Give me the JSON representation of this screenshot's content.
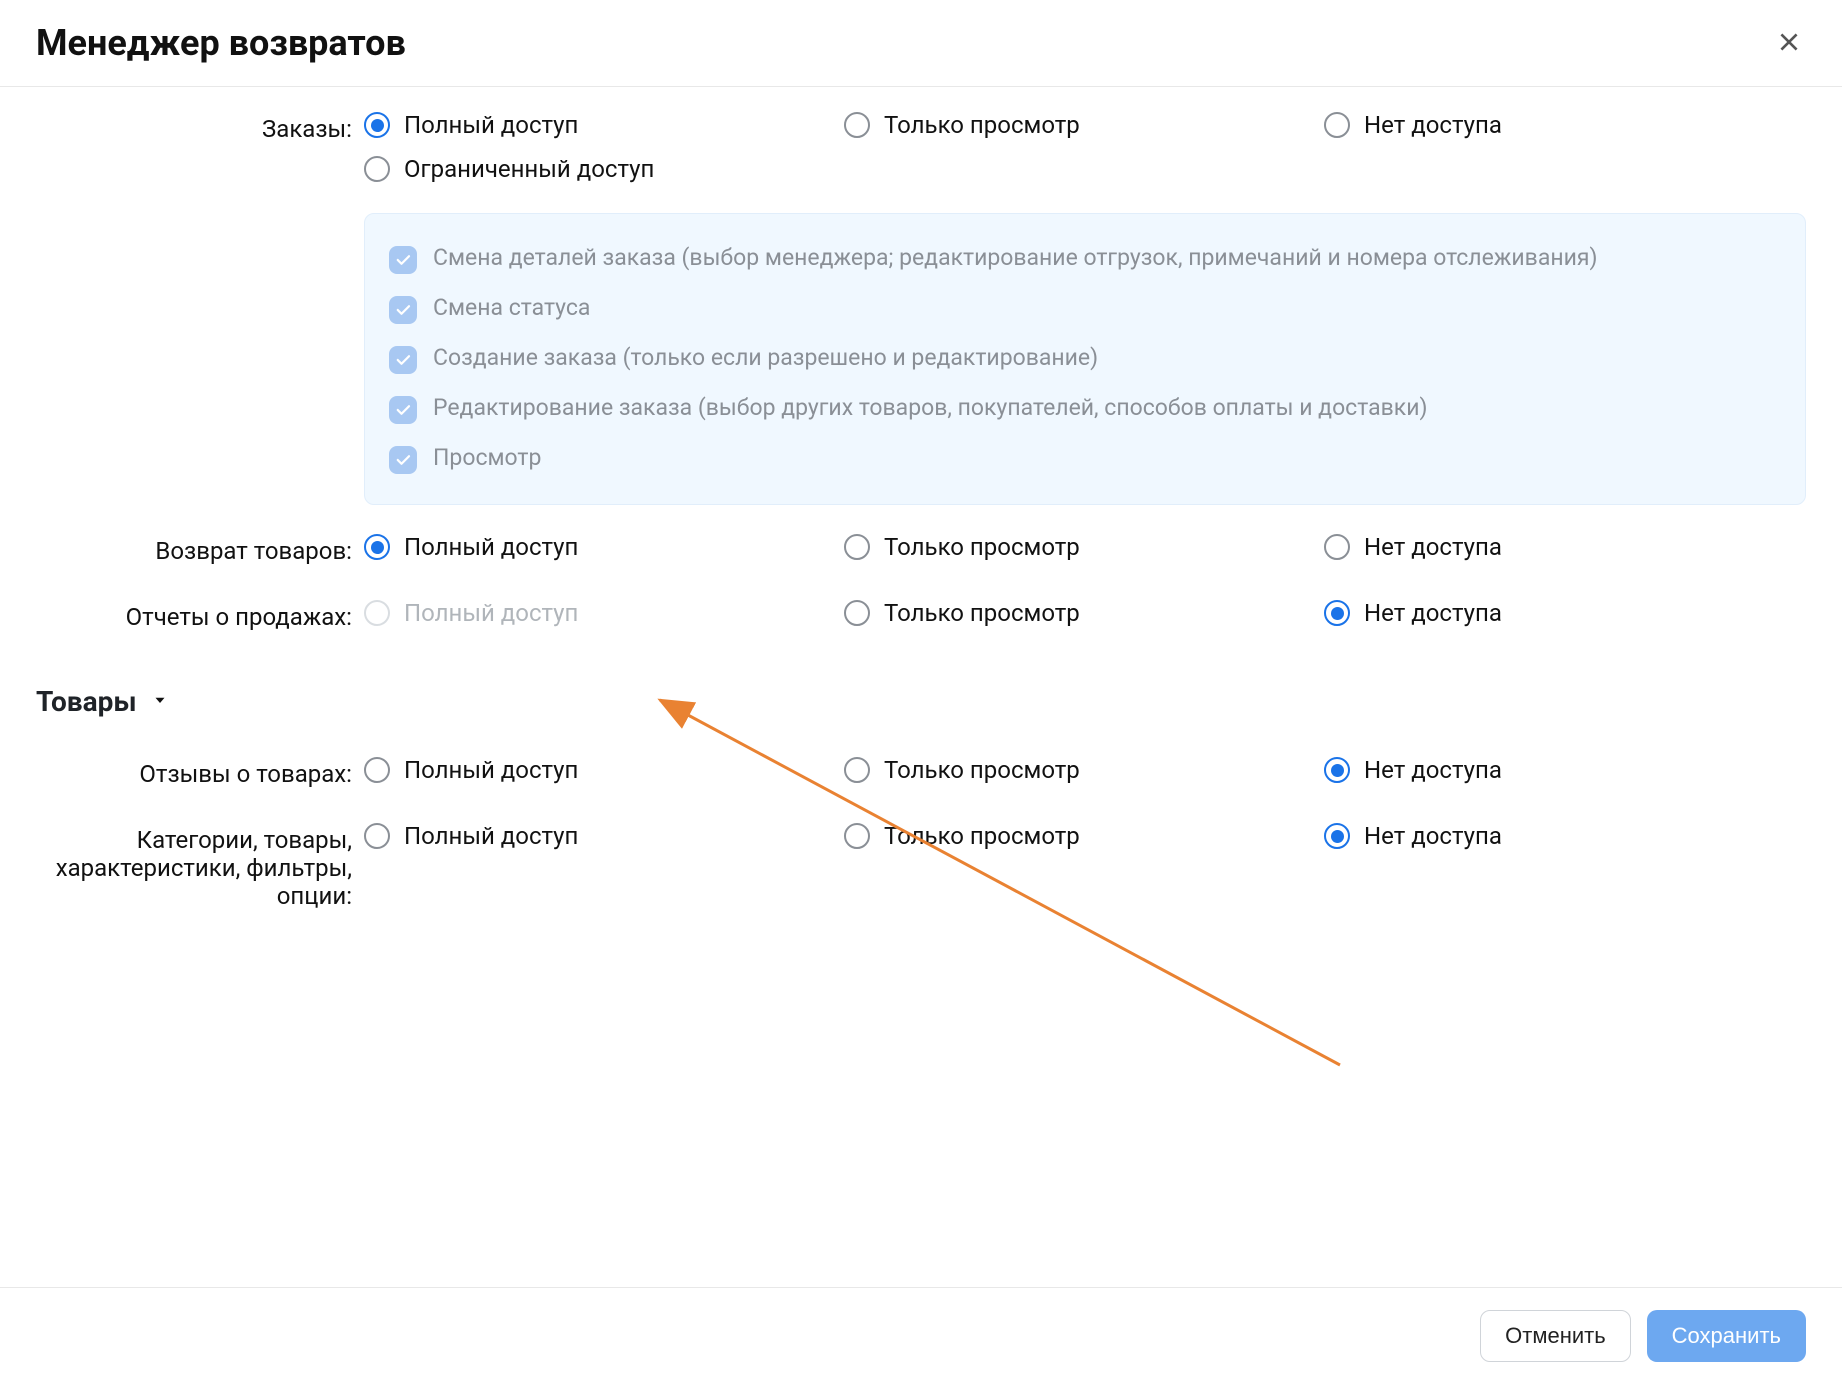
{
  "modal": {
    "title": "Менеджер возвратов",
    "close_aria": "Закрыть"
  },
  "options": {
    "full": "Полный доступ",
    "view": "Только просмотр",
    "none": "Нет доступа",
    "limited": "Ограниченный доступ"
  },
  "orders": {
    "label": "Заказы:",
    "selected": "full",
    "sub": {
      "change_details": "Смена деталей заказа (выбор менеджера; редактирование отгрузок, примечаний и номера отслеживания)",
      "change_status": "Смена статуса",
      "create_order": "Создание заказа (только если разрешено и редактирование)",
      "edit_order": "Редактирование заказа (выбор других товаров, покупателей, способов оплаты и доставки)",
      "view_order": "Просмотр"
    }
  },
  "returns": {
    "label": "Возврат товаров:",
    "selected": "full"
  },
  "sales_reports": {
    "label": "Отчеты о продажах:",
    "selected": "none",
    "full_disabled": true
  },
  "section_products": {
    "title": "Товары"
  },
  "product_reviews": {
    "label": "Отзывы о товарах:",
    "selected": "none"
  },
  "catalog": {
    "label": "Категории, товары, характеристики, фильтры, опции:",
    "selected": "none"
  },
  "footer": {
    "cancel": "Отменить",
    "save": "Сохранить"
  }
}
